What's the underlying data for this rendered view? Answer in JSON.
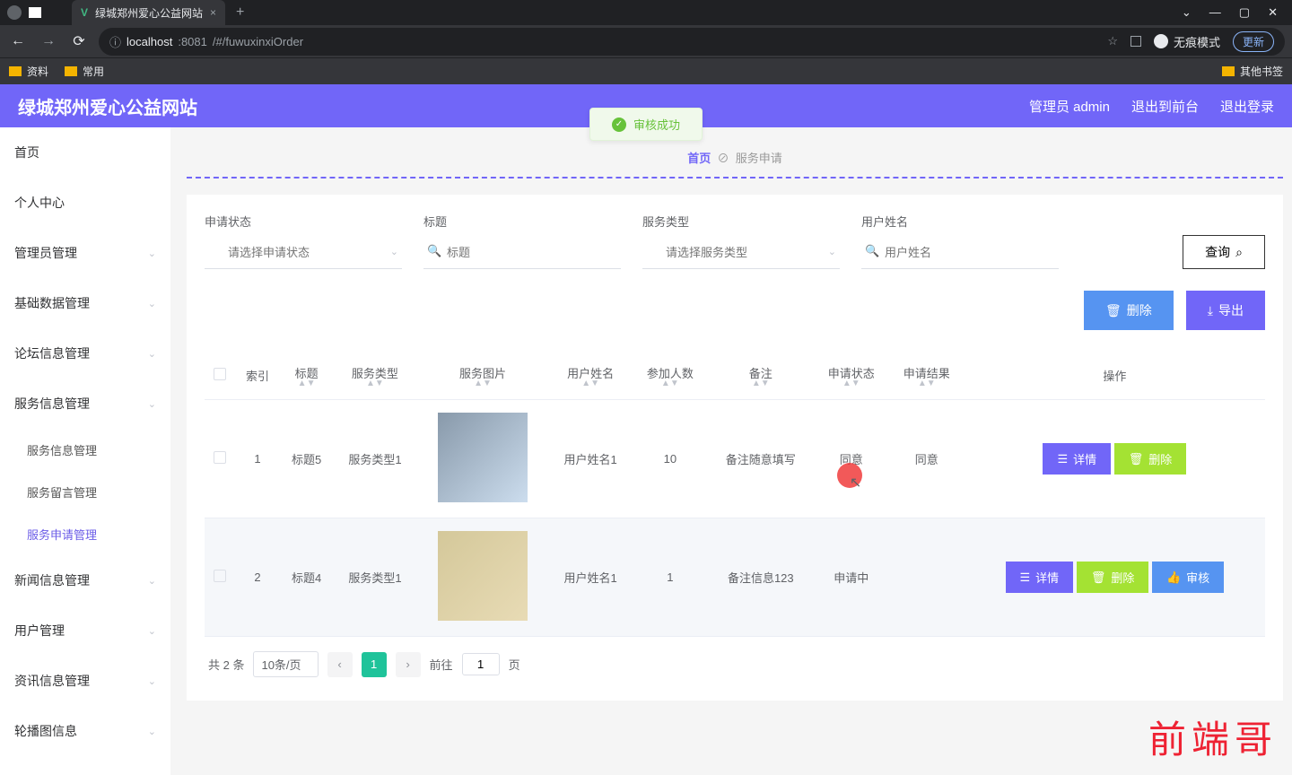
{
  "browser": {
    "tab_title": "绿城郑州爱心公益网站",
    "url_host": "localhost",
    "url_port": ":8081",
    "url_path": "/#/fuwuxinxiOrder",
    "incognito": "无痕模式",
    "update": "更新",
    "bookmarks": {
      "b1": "资料",
      "b2": "常用",
      "other": "其他书签"
    }
  },
  "header": {
    "title": "绿城郑州爱心公益网站",
    "user": "管理员 admin",
    "exit_front": "退出到前台",
    "logout": "退出登录"
  },
  "toast": {
    "msg": "审核成功"
  },
  "breadcrumb": {
    "home": "首页",
    "current": "服务申请"
  },
  "sidebar": {
    "home": "首页",
    "personal": "个人中心",
    "admin": "管理员管理",
    "base": "基础数据管理",
    "forum": "论坛信息管理",
    "service_mgmt": "服务信息管理",
    "sub_service_info": "服务信息管理",
    "sub_service_msg": "服务留言管理",
    "sub_service_apply": "服务申请管理",
    "news": "新闻信息管理",
    "users": "用户管理",
    "info": "资讯信息管理",
    "carousel": "轮播图信息"
  },
  "filters": {
    "status_label": "申请状态",
    "status_ph": "请选择申请状态",
    "title_label": "标题",
    "title_ph": "标题",
    "type_label": "服务类型",
    "type_ph": "请选择服务类型",
    "user_label": "用户姓名",
    "user_ph": "用户姓名",
    "query": "查询"
  },
  "actions": {
    "delete": "删除",
    "export": "导出"
  },
  "table": {
    "cols": {
      "index": "索引",
      "title": "标题",
      "type": "服务类型",
      "img": "服务图片",
      "user": "用户姓名",
      "count": "参加人数",
      "note": "备注",
      "status": "申请状态",
      "result": "申请结果",
      "op": "操作"
    },
    "rows": [
      {
        "index": "1",
        "title": "标题5",
        "type": "服务类型1",
        "user": "用户姓名1",
        "count": "10",
        "note": "备注随意填写",
        "status": "同意",
        "result": "同意"
      },
      {
        "index": "2",
        "title": "标题4",
        "type": "服务类型1",
        "user": "用户姓名1",
        "count": "1",
        "note": "备注信息123",
        "status": "申请中",
        "result": ""
      }
    ],
    "btn_detail": "详情",
    "btn_delete": "删除",
    "btn_audit": "审核"
  },
  "pager": {
    "total": "共 2 条",
    "per_page": "10条/页",
    "page": "1",
    "goto_pre": "前往",
    "goto_input": "1",
    "goto_suf": "页"
  },
  "watermark": "前端哥"
}
